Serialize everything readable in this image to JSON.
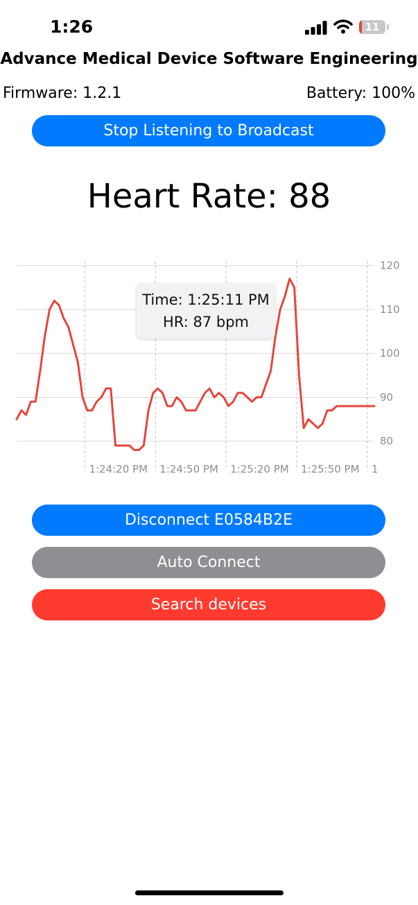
{
  "status_bar": {
    "time": "1:26",
    "battery_text": "11",
    "battery_level": 0.11,
    "battery_color": "#e5463e",
    "signal_bars": 4
  },
  "app": {
    "title": "Advance Medical Device Software Engineering",
    "firmware": "Firmware: 1.2.1",
    "battery": "Battery: 100%"
  },
  "buttons": {
    "stop_broadcast": {
      "label": "Stop Listening to Broadcast",
      "color": "#007aff"
    },
    "disconnect": {
      "label": "Disconnect E0584B2E",
      "color": "#007aff"
    },
    "auto_connect": {
      "label": "Auto Connect",
      "color": "#8e8e93"
    },
    "search": {
      "label": "Search devices",
      "color": "#ff3b30"
    }
  },
  "heart_rate": {
    "label": "Heart Rate: 88"
  },
  "tooltip": {
    "time": "Time: 1:25:11 PM",
    "hr": "HR: 87 bpm"
  },
  "chart_data": {
    "type": "line",
    "series": [
      {
        "color": "#e5463e",
        "x": [
          0,
          2,
          4,
          6,
          8,
          10,
          12,
          14,
          16,
          18,
          20,
          22,
          24,
          26,
          28,
          30,
          32,
          34,
          36,
          38,
          40,
          42,
          44,
          46,
          48,
          50,
          52,
          54,
          56,
          58,
          60,
          62,
          64,
          66,
          68,
          70,
          72,
          74,
          76,
          78,
          80,
          82,
          84,
          86,
          88,
          90,
          92,
          94,
          96,
          98,
          100,
          102,
          104,
          106,
          108,
          110,
          112,
          114,
          116,
          118,
          120,
          122,
          124,
          126,
          128,
          130,
          132,
          134,
          136,
          138,
          140,
          142,
          144,
          146,
          148,
          150,
          152
        ],
        "values": [
          85,
          87,
          86,
          89,
          89,
          96,
          104,
          110,
          112,
          111,
          108,
          106,
          102,
          98,
          90,
          87,
          87,
          89,
          90,
          92,
          92,
          79,
          79,
          79,
          79,
          78,
          78,
          79,
          87,
          91,
          92,
          91,
          88,
          88,
          90,
          89,
          87,
          87,
          87,
          89,
          91,
          92,
          90,
          91,
          90,
          88,
          89,
          91,
          91,
          90,
          89,
          90,
          90,
          93,
          96,
          104,
          110,
          113,
          117,
          115,
          95,
          83,
          85,
          84,
          83,
          84,
          87,
          87,
          88,
          88,
          88,
          88,
          88,
          88,
          88,
          88,
          88
        ]
      }
    ],
    "x_range": [
      0,
      152
    ],
    "xtick_positions": [
      29,
      59,
      89,
      119,
      149
    ],
    "xtick_labels": [
      "1:24:20 PM",
      "1:24:50 PM",
      "1:25:20 PM",
      "1:25:50 PM",
      "1"
    ],
    "ylim": [
      73,
      122
    ],
    "yticks": [
      80,
      90,
      100,
      110,
      120
    ],
    "grid": true,
    "y_axis_side": "right",
    "legend": "none"
  }
}
